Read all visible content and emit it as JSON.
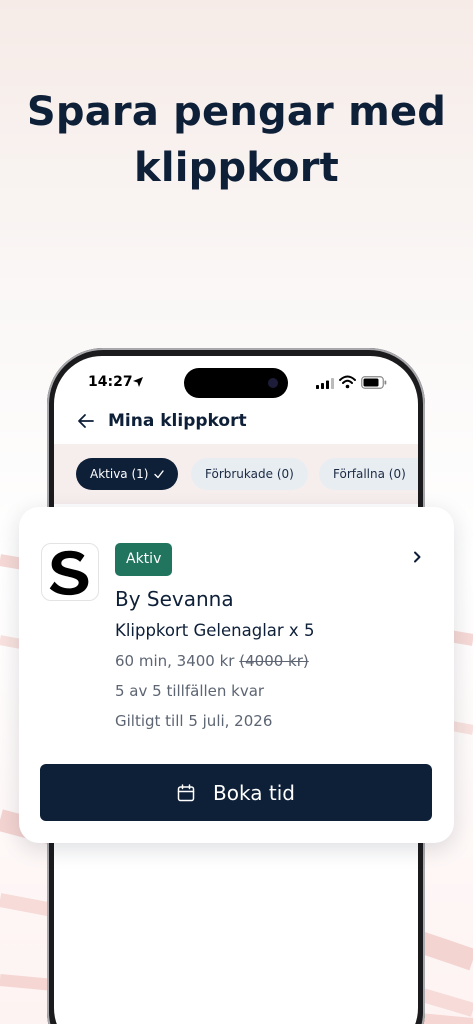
{
  "headline": "Spara pengar med klippkort",
  "status_bar": {
    "time": "14:27",
    "location_icon": "location-arrow-icon",
    "signal_icon": "cellular-signal-icon",
    "wifi_icon": "wifi-icon",
    "battery_icon": "battery-icon"
  },
  "header": {
    "back_icon": "arrow-left-icon",
    "title": "Mina klippkort"
  },
  "filters": [
    {
      "label": "Aktiva (1)",
      "selected": true,
      "icon": "check-icon"
    },
    {
      "label": "Förbrukade (0)",
      "selected": false
    },
    {
      "label": "Förfallna (0)",
      "selected": false
    }
  ],
  "card": {
    "logo_letter": "S",
    "status_badge": "Aktiv",
    "provider": "By Sevanna",
    "product": "Klippkort Gelenaglar x 5",
    "duration_price": "60 min, 3400 kr",
    "original_price": "(4000 kr)",
    "remaining": "5 av 5 tillfällen kvar",
    "valid_until": "Giltigt till 5 juli, 2026",
    "chevron_icon": "chevron-right-icon",
    "book_button_label": "Boka tid",
    "book_button_icon": "calendar-icon"
  },
  "colors": {
    "primary": "#0e1f38",
    "badge_green": "#21745d",
    "chip_inactive": "#e8edf2",
    "text_secondary": "#5d6573",
    "background_tint": "#f6ebe7"
  }
}
